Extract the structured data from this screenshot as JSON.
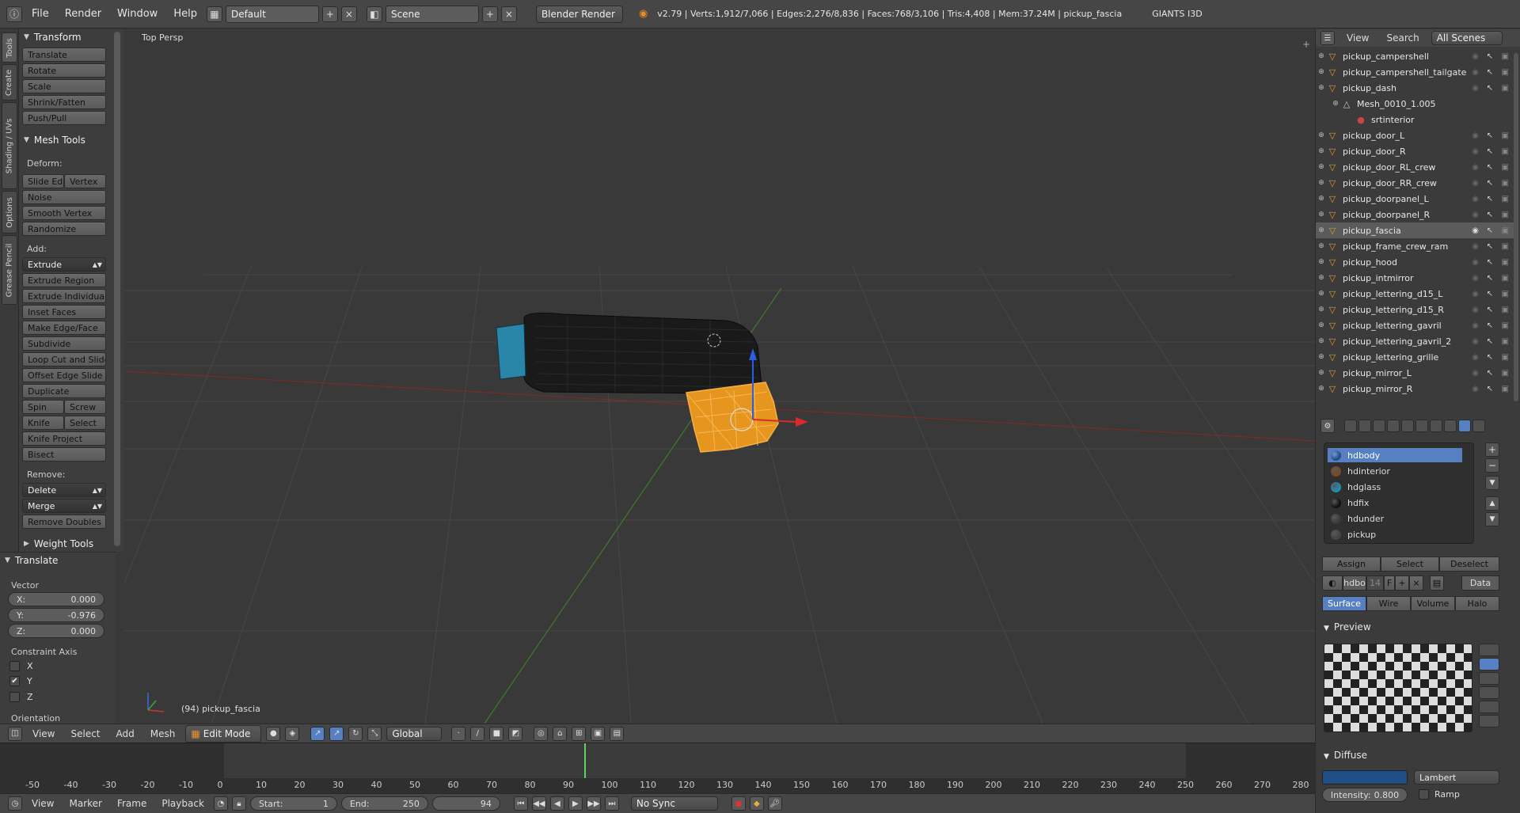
{
  "topbar": {
    "menus": [
      "File",
      "Render",
      "Window",
      "Help"
    ],
    "layout": "Default",
    "scene": "Scene",
    "engine": "Blender Render",
    "stats": "v2.79 | Verts:1,912/7,066 | Edges:2,276/8,836 | Faces:768/3,106 | Tris:4,408 | Mem:37.24M | pickup_fascia",
    "plugin": "GIANTS I3D"
  },
  "lefttabs": [
    "Tools",
    "Create",
    "Shading / UVs",
    "Options",
    "Grease Pencil"
  ],
  "toolshelf": {
    "transform_title": "Transform",
    "transform": [
      "Translate",
      "Rotate",
      "Scale",
      "Shrink/Fatten",
      "Push/Pull"
    ],
    "mesh_tools_title": "Mesh Tools",
    "deform_label": "Deform:",
    "slide_edge": "Slide Ed",
    "vertex": "Vertex",
    "deform": [
      "Noise",
      "Smooth Vertex",
      "Randomize"
    ],
    "add_label": "Add:",
    "extrude": "Extrude",
    "add": [
      "Extrude Region",
      "Extrude Individual",
      "Inset Faces",
      "Make Edge/Face",
      "Subdivide",
      "Loop Cut and Slide",
      "Offset Edge Slide",
      "Duplicate"
    ],
    "spin": "Spin",
    "screw": "Screw",
    "knife": "Knife",
    "select": "Select",
    "add2": [
      "Knife Project",
      "Bisect"
    ],
    "remove_label": "Remove:",
    "delete": "Delete",
    "merge": "Merge",
    "remove_doubles": "Remove Doubles",
    "weight_tools": "Weight Tools"
  },
  "redo": {
    "title": "Translate",
    "vector_label": "Vector",
    "x": "X:",
    "x_val": "0.000",
    "y": "Y:",
    "y_val": "-0.976",
    "z": "Z:",
    "z_val": "0.000",
    "constraint_label": "Constraint Axis",
    "cx": "X",
    "cy": "Y",
    "cz": "Z",
    "cy_checked": true,
    "orientation": "Orientation"
  },
  "viewport": {
    "view_label": "Top Persp",
    "object_label": "(94) pickup_fascia"
  },
  "header3d": {
    "items": [
      "View",
      "Select",
      "Add",
      "Mesh"
    ],
    "mode": "Edit Mode",
    "orientation": "Global"
  },
  "timeline": {
    "ticks": [
      "-50",
      "-40",
      "-30",
      "-20",
      "-10",
      "0",
      "10",
      "20",
      "30",
      "40",
      "50",
      "60",
      "70",
      "80",
      "90",
      "100",
      "110",
      "120",
      "130",
      "140",
      "150",
      "160",
      "170",
      "180",
      "190",
      "200",
      "210",
      "220",
      "230",
      "240",
      "250",
      "260",
      "270",
      "280"
    ],
    "current_frame": 94
  },
  "bottombar": {
    "items": [
      "View",
      "Marker",
      "Frame",
      "Playback"
    ],
    "start_label": "Start:",
    "start": "1",
    "end_label": "End:",
    "end": "250",
    "frame": "94",
    "sync": "No Sync"
  },
  "outliner": {
    "view": "View",
    "search": "Search",
    "scenes": "All Scenes",
    "rows": [
      {
        "name": "pickup_campershell",
        "type": "object"
      },
      {
        "name": "pickup_campershell_tailgate",
        "type": "object"
      },
      {
        "name": "pickup_dash",
        "type": "object"
      },
      {
        "name": "Mesh_0010_1.005",
        "type": "mesh"
      },
      {
        "name": "srtinterior",
        "type": "material"
      },
      {
        "name": "pickup_door_L",
        "type": "object"
      },
      {
        "name": "pickup_door_R",
        "type": "object"
      },
      {
        "name": "pickup_door_RL_crew",
        "type": "object"
      },
      {
        "name": "pickup_door_RR_crew",
        "type": "object"
      },
      {
        "name": "pickup_doorpanel_L",
        "type": "object"
      },
      {
        "name": "pickup_doorpanel_R",
        "type": "object"
      },
      {
        "name": "pickup_fascia",
        "type": "object",
        "selected": true
      },
      {
        "name": "pickup_frame_crew_ram",
        "type": "object"
      },
      {
        "name": "pickup_hood",
        "type": "object"
      },
      {
        "name": "pickup_intmirror",
        "type": "object"
      },
      {
        "name": "pickup_lettering_d15_L",
        "type": "object"
      },
      {
        "name": "pickup_lettering_d15_R",
        "type": "object"
      },
      {
        "name": "pickup_lettering_gavril",
        "type": "object"
      },
      {
        "name": "pickup_lettering_gavril_2",
        "type": "object"
      },
      {
        "name": "pickup_lettering_grille",
        "type": "object"
      },
      {
        "name": "pickup_mirror_L",
        "type": "object"
      },
      {
        "name": "pickup_mirror_R",
        "type": "object"
      }
    ]
  },
  "properties": {
    "materials": [
      {
        "name": "hdbody",
        "color": "#1f4f86",
        "selected": true
      },
      {
        "name": "hdinterior",
        "color": "#7a4a22"
      },
      {
        "name": "hdglass",
        "color": "#1d8fb3"
      },
      {
        "name": "hdfix",
        "color": "#111111"
      },
      {
        "name": "hdunder",
        "color": "#3b3b3b"
      },
      {
        "name": "pickup",
        "color": "#444444"
      }
    ],
    "assign": "Assign",
    "select": "Select",
    "deselect": "Deselect",
    "mat_name": "hdbo",
    "users": "14",
    "fake": "F",
    "data": "Data",
    "tabs": [
      "Surface",
      "Wire",
      "Volume",
      "Halo"
    ],
    "preview_title": "Preview",
    "diffuse_title": "Diffuse",
    "diffuse_color": "#1f4f86",
    "shader": "Lambert",
    "intensity_label": "Intensity:",
    "intensity": "0.800",
    "ramp": "Ramp"
  }
}
